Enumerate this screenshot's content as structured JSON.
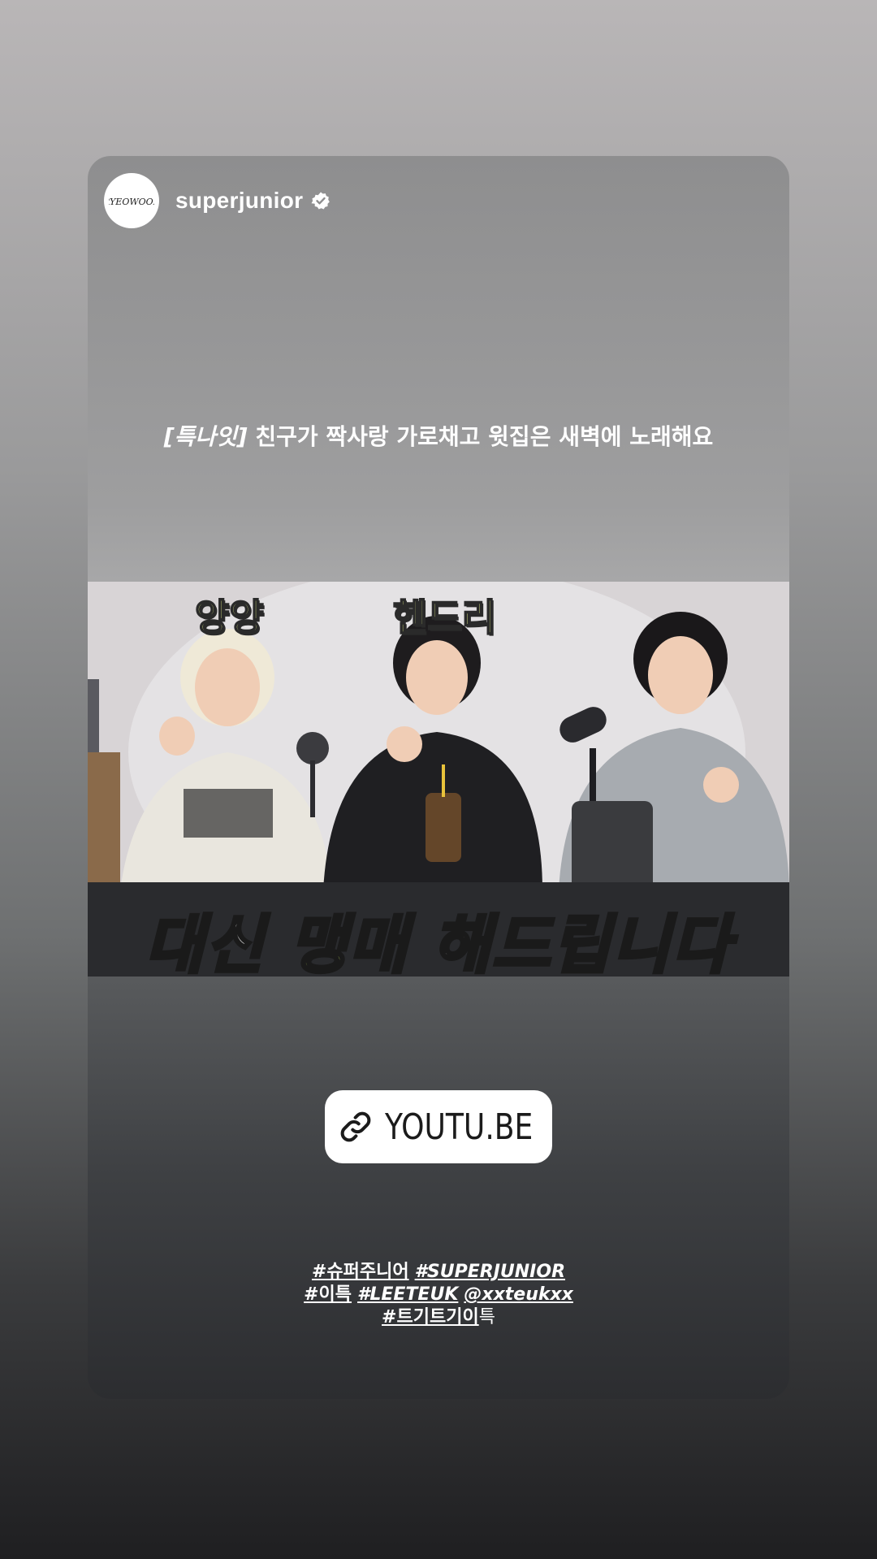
{
  "story": {
    "username": "superjunior",
    "avatar_logo": "RYEOWOOK",
    "caption_bracket": "[특나잇]",
    "caption_text": " 친구가 짝사랑 가로채고 윗집은 새벽에 노래해요"
  },
  "thumbnail": {
    "name_left": "양양",
    "name_center": "헨드리",
    "title_part1": "대신 ",
    "title_highlight": "맹매",
    "title_part2": " 해드립니다"
  },
  "link_sticker": {
    "icon": "link-icon",
    "label": "YOUTU.BE"
  },
  "hashtags": {
    "line1_a": "#슈퍼주니어",
    "line1_b": "#SUPERJUNIOR",
    "line2_a": "#이특",
    "line2_b": "#LEETEUK",
    "line2_c": "@xxteukxx",
    "line3_a": "#트기트기이",
    "line3_b": "특"
  },
  "colors": {
    "highlight": "#d9ff6a",
    "name_tag": "#e7f58a",
    "verified": "#ffffff"
  }
}
